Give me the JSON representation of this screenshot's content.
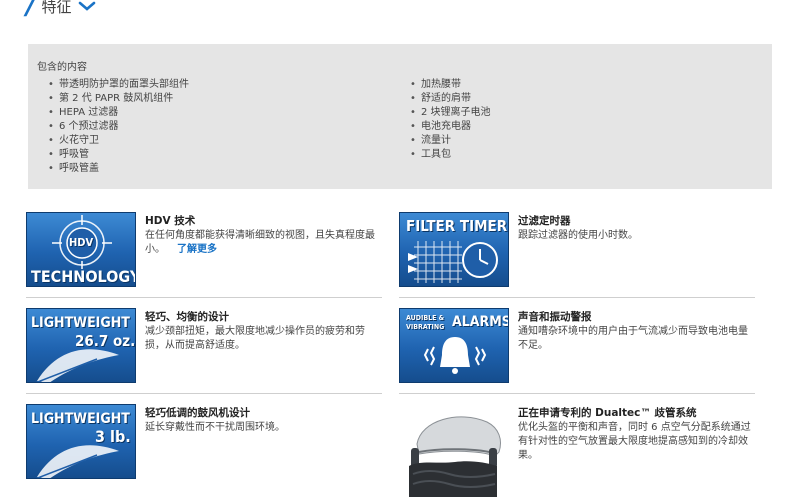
{
  "heading": {
    "title": "特征"
  },
  "contents": {
    "label": "包含的内容",
    "left": [
      "带透明防护罩的面罩头部组件",
      "第 2 代 PAPR 鼓风机组件",
      "HEPA 过滤器",
      "6 个预过滤器",
      "火花守卫",
      "呼吸管",
      "呼吸管盖"
    ],
    "right": [
      "加热腰带",
      "舒适的肩带",
      "2 块锂离子电池",
      "电池充电器",
      "流量计",
      "工具包"
    ]
  },
  "features": {
    "hdv": {
      "title": "HDV 技术",
      "desc": "在任何角度都能获得清晰细致的视图，且失真程度最小。",
      "link": "了解更多",
      "tile_line1": "HDV",
      "tile_line2": "TECHNOLOGY"
    },
    "filter": {
      "title": "过滤定时器",
      "desc": "跟踪过滤器的使用小时数。",
      "tile_line1": "FILTER TIMER"
    },
    "light1": {
      "title": "轻巧、均衡的设计",
      "desc": "减少颈部扭矩，最大限度地减少操作员的疲劳和劳损，从而提高舒适度。",
      "tile_line1": "LIGHTWEIGHT",
      "tile_line2": "26.7 oz."
    },
    "alarm": {
      "title": "声音和振动警报",
      "desc": "通知嘈杂环境中的用户由于气流减少而导致电池电量不足。",
      "tile_small1": "AUDIBLE &",
      "tile_small2": "VIBRATING",
      "tile_big": "ALARMS"
    },
    "light2": {
      "title": "轻巧低调的鼓风机设计",
      "desc": "延长穿戴性而不干扰周围环境。",
      "tile_line1": "LIGHTWEIGHT",
      "tile_line2": "3 lb."
    },
    "dualtec": {
      "title": "正在申请专利的 Dualtec™ 歧管系统",
      "desc": "优化头盔的平衡和声音，同时 6 点空气分配系统通过有针对性的空气放置最大限度地提高感知到的冷却效果。"
    }
  }
}
